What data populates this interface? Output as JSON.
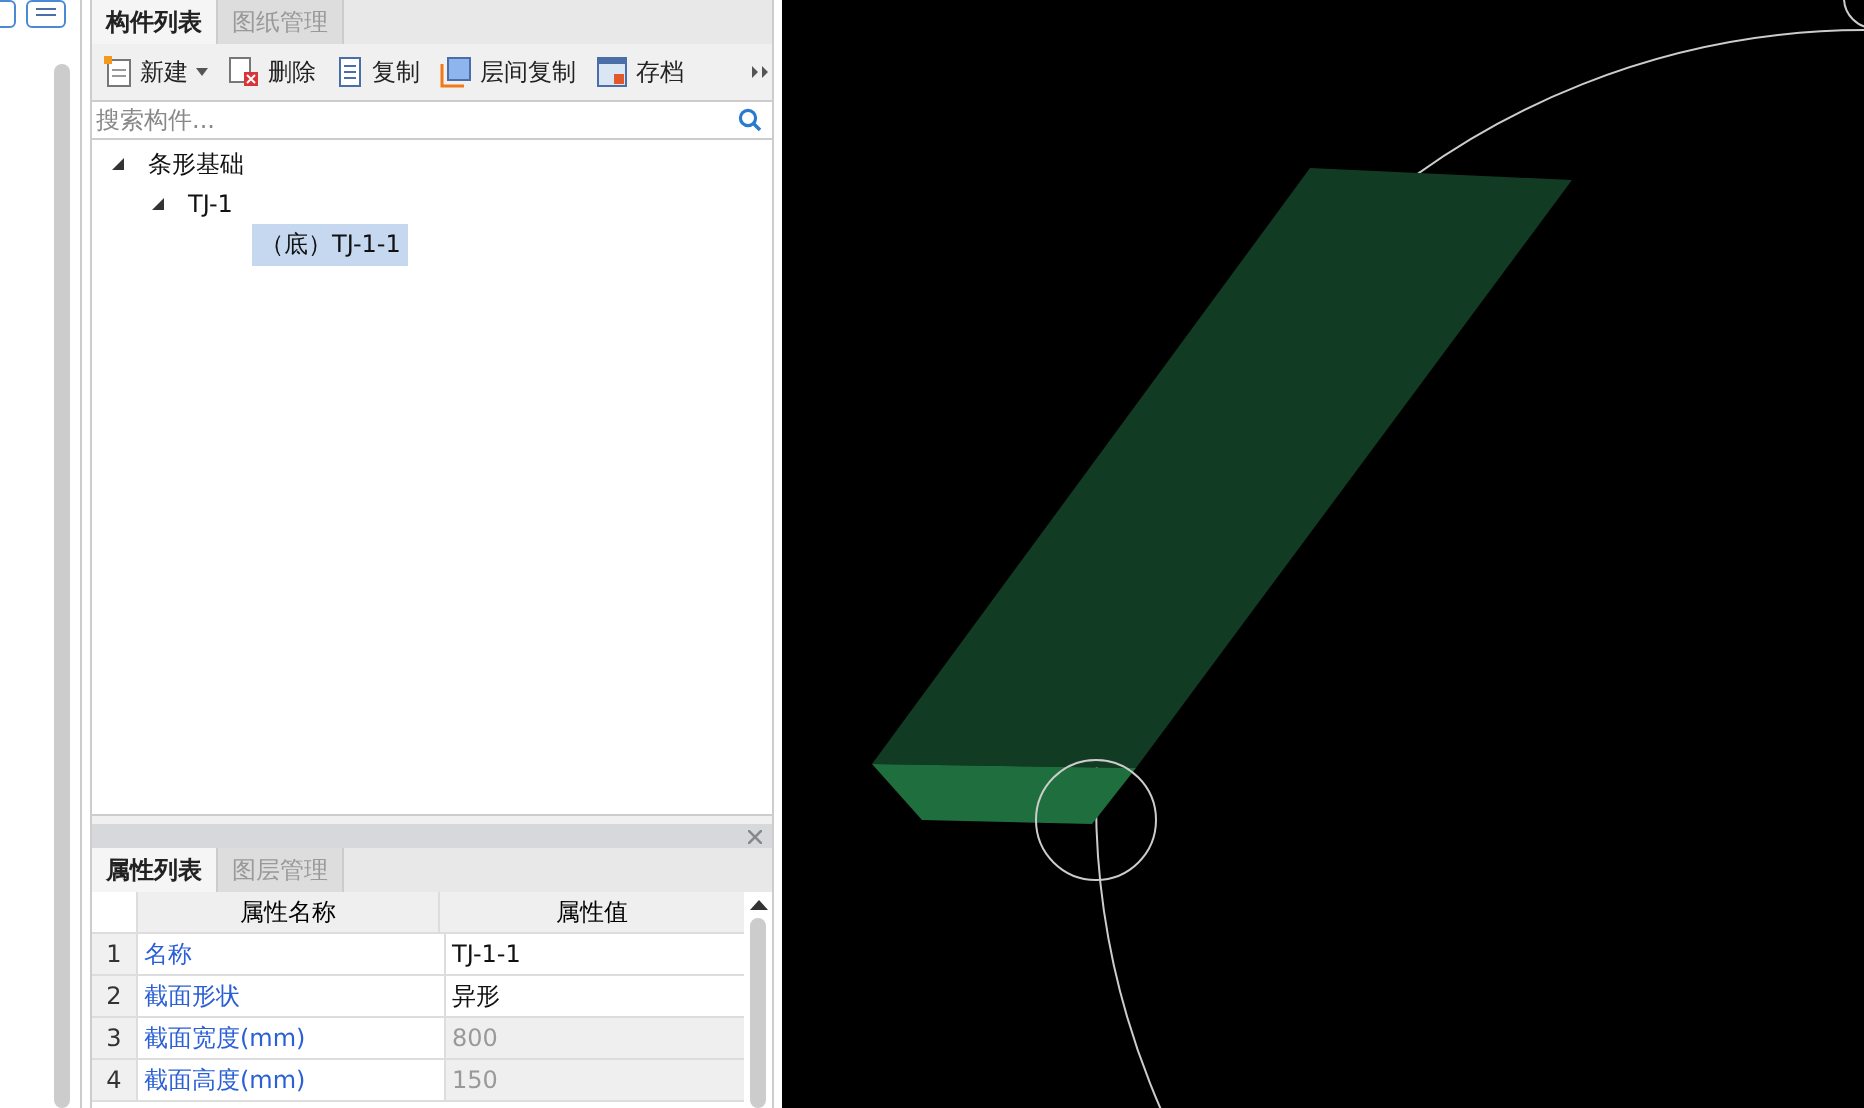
{
  "component_panel": {
    "tabs": [
      {
        "label": "构件列表",
        "selected": true
      },
      {
        "label": "图纸管理",
        "selected": false
      }
    ],
    "toolbar": [
      {
        "kind": "new",
        "label": "新建",
        "dropdown": true
      },
      {
        "kind": "delete",
        "label": "删除",
        "dropdown": false
      },
      {
        "kind": "copy",
        "label": "复制",
        "dropdown": false
      },
      {
        "kind": "floor-copy",
        "label": "层间复制",
        "dropdown": false
      },
      {
        "kind": "save",
        "label": "存档",
        "dropdown": false
      }
    ],
    "search": {
      "placeholder": "搜索构件..."
    },
    "tree": [
      {
        "label": "条形基础",
        "expanded": true,
        "selected": false,
        "children": [
          {
            "label": "TJ-1",
            "expanded": true,
            "selected": false,
            "children": [
              {
                "label": "（底）TJ-1-1",
                "selected": true
              }
            ]
          }
        ]
      }
    ]
  },
  "property_panel": {
    "tabs": [
      {
        "label": "属性列表",
        "selected": true
      },
      {
        "label": "图层管理",
        "selected": false
      }
    ],
    "columns": [
      "属性名称",
      "属性值"
    ],
    "rows": [
      {
        "index": "1",
        "name": "名称",
        "value": "TJ-1-1",
        "disabled": false
      },
      {
        "index": "2",
        "name": "截面形状",
        "value": "异形",
        "disabled": false
      },
      {
        "index": "3",
        "name": "截面宽度(mm)",
        "value": "800",
        "disabled": true
      },
      {
        "index": "4",
        "name": "截面高度(mm)",
        "value": "150",
        "disabled": true
      }
    ]
  }
}
